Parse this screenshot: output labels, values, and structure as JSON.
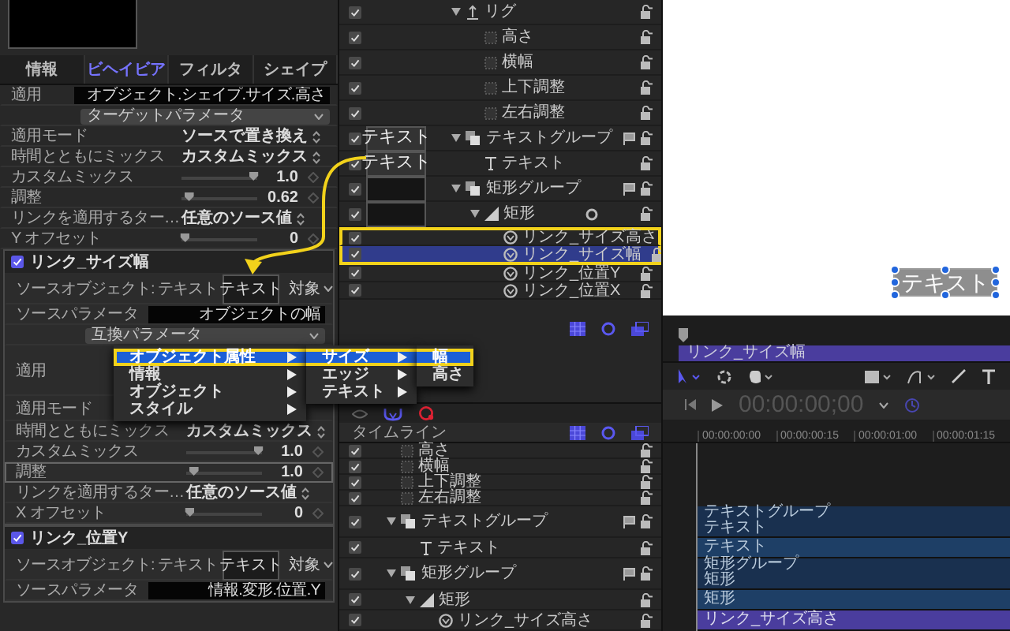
{
  "inspector": {
    "tabs": [
      {
        "label": "情報",
        "selected": false
      },
      {
        "label": "ビヘイビア",
        "selected": true
      },
      {
        "label": "フィルタ",
        "selected": false
      },
      {
        "label": "シェイプ",
        "selected": false
      }
    ],
    "sections": [
      {
        "rows": [
          {
            "kind": "field",
            "label": "適用",
            "value": "オブジェクト.シェイプ.サイズ.高さ",
            "focused": false
          },
          {
            "kind": "dropdown",
            "value": "ターゲットパラメータ",
            "focused": false
          },
          {
            "kind": "popup",
            "label": "適用モード",
            "value": "ソースで置き換え",
            "focused": false
          },
          {
            "kind": "popup",
            "label": "時間とともにミックス",
            "value": "カスタムミックス",
            "focused": false
          },
          {
            "kind": "slider",
            "label": "カスタムミックス",
            "level": 0.95,
            "value": "1.0",
            "focused": false
          },
          {
            "kind": "slider",
            "label": "調整",
            "level": 0.1,
            "value": "0.62",
            "focused": false
          },
          {
            "kind": "popup",
            "label": "リンクを適用するター…",
            "value": "任意のソース値",
            "focused": false
          },
          {
            "kind": "slider",
            "label": "Y オフセット",
            "level": 0.05,
            "value": "0",
            "focused": false
          }
        ]
      },
      {
        "title": "リンク_サイズ幅",
        "enabled": true,
        "rows": [
          {
            "kind": "source",
            "label": "ソースオブジェクト: テキスト",
            "thumbnail": "テキスト",
            "button": "対象",
            "focused": false
          },
          {
            "kind": "field",
            "label": "ソースパラメータ",
            "value": "オブジェクトの幅",
            "focused": false
          },
          {
            "kind": "dropdown",
            "value": "互換パラメータ",
            "focused": false
          },
          {
            "kind": "covered",
            "label": "適用",
            "focused": false
          },
          {
            "kind": "covered_short",
            "label": "適用モード",
            "focused": false
          },
          {
            "kind": "popup",
            "label": "時間とともにミックス",
            "value": "カスタムミックス",
            "focused": false
          },
          {
            "kind": "slider",
            "label": "カスタムミックス",
            "level": 0.95,
            "value": "1.0",
            "focused": false
          },
          {
            "kind": "slider",
            "label": "調整",
            "level": 0.1,
            "value": "1.0",
            "focused": true
          },
          {
            "kind": "popup",
            "label": "リンクを適用するター…",
            "value": "任意のソース値",
            "focused": false
          },
          {
            "kind": "slider",
            "label": "X オフセット",
            "level": 0.05,
            "value": "0",
            "focused": false
          }
        ]
      },
      {
        "title": "リンク_位置Y",
        "enabled": true,
        "rows": [
          {
            "kind": "source",
            "label": "ソースオブジェクト: テキスト",
            "thumbnail": "テキスト",
            "button": "対象",
            "focused": false
          },
          {
            "kind": "field",
            "label": "ソースパラメータ",
            "value": "情報.変形.位置.Y",
            "focused": false
          }
        ]
      }
    ]
  },
  "menu": {
    "columns": [
      {
        "items": [
          {
            "label": "オブジェクト属性",
            "submenu": true,
            "selected": true
          },
          {
            "label": "情報",
            "submenu": true,
            "selected": false
          },
          {
            "label": "オブジェクト",
            "submenu": true,
            "selected": false
          },
          {
            "label": "スタイル",
            "submenu": true,
            "selected": false
          }
        ]
      },
      {
        "items": [
          {
            "label": "サイズ",
            "submenu": true,
            "selected": true
          },
          {
            "label": "エッジ",
            "submenu": true,
            "selected": false
          },
          {
            "label": "テキスト",
            "submenu": true,
            "selected": false
          }
        ]
      },
      {
        "items": [
          {
            "label": "幅",
            "submenu": false,
            "selected": true
          },
          {
            "label": "高さ",
            "submenu": false,
            "selected": false
          }
        ]
      }
    ]
  },
  "layers": {
    "items": [
      {
        "name": "リグ",
        "kind": "rig",
        "checked": true,
        "selected": false,
        "expanded": true,
        "children": [
          {
            "name": "高さ",
            "kind": "param",
            "checked": true,
            "selected": false
          },
          {
            "name": "横幅",
            "kind": "param",
            "checked": true,
            "selected": false
          },
          {
            "name": "上下調整",
            "kind": "param",
            "checked": true,
            "selected": false
          },
          {
            "name": "左右調整",
            "kind": "param",
            "checked": true,
            "selected": false
          }
        ]
      },
      {
        "name": "テキストグループ",
        "kind": "group",
        "checked": true,
        "selected": false,
        "expanded": true,
        "preview": {
          "kind": "text",
          "label": "テキスト"
        },
        "children": [
          {
            "name": "テキスト",
            "kind": "text",
            "checked": true,
            "selected": false,
            "preview": {
              "kind": "text",
              "label": "テキスト"
            }
          }
        ]
      },
      {
        "name": "矩形グループ",
        "kind": "group",
        "checked": true,
        "selected": false,
        "expanded": true,
        "preview": {
          "kind": "blank"
        },
        "children": [
          {
            "name": "矩形",
            "kind": "shape",
            "checked": true,
            "selected": false,
            "expanded": true,
            "preview": {
              "kind": "blank"
            },
            "children": [
              {
                "name": "リンク_サイズ高さ",
                "kind": "behavior",
                "checked": true,
                "selected": false,
                "highlighted": true
              },
              {
                "name": "リンク_サイズ幅",
                "kind": "behavior",
                "checked": true,
                "selected": true,
                "highlighted": true
              },
              {
                "name": "リンク_位置Y",
                "kind": "behavior",
                "checked": true,
                "selected": false,
                "highlighted": false
              },
              {
                "name": "リンク_位置X",
                "kind": "behavior",
                "checked": true,
                "selected": false,
                "highlighted": false
              }
            ]
          }
        ]
      }
    ]
  },
  "timeline_header": {
    "title": "タイムライン"
  },
  "timeline_layers": {
    "items": [
      {
        "name": "高さ",
        "kind": "param",
        "checked": true,
        "selected": false
      },
      {
        "name": "横幅",
        "kind": "param",
        "checked": true,
        "selected": false
      },
      {
        "name": "上下調整",
        "kind": "param",
        "checked": true,
        "selected": false
      },
      {
        "name": "左右調整",
        "kind": "param",
        "checked": true,
        "selected": false
      },
      {
        "name": "テキストグループ",
        "kind": "group",
        "checked": true,
        "selected": false,
        "expanded": true,
        "children": [
          {
            "name": "テキスト",
            "kind": "text",
            "checked": true,
            "selected": false
          }
        ]
      },
      {
        "name": "矩形グループ",
        "kind": "group",
        "checked": true,
        "selected": false,
        "expanded": true,
        "children": [
          {
            "name": "矩形",
            "kind": "shape",
            "checked": true,
            "selected": false,
            "expanded": true,
            "children": [
              {
                "name": "リンク_サイズ高さ",
                "kind": "behavior",
                "checked": true,
                "selected": false
              }
            ]
          }
        ]
      }
    ]
  },
  "canvas": {
    "object_text": "テキスト"
  },
  "mini_timeline": {
    "bar": {
      "kind": "behavior",
      "label": "リンク_サイズ幅"
    }
  },
  "transport": {
    "timecode": "00:00:00;00"
  },
  "timeline": {
    "ticks": [
      "00:00:00:00",
      "00:00:00:15",
      "00:00:01:00",
      "00:00:01:15"
    ],
    "tracks": [
      {
        "kind": "group",
        "lines": [
          "テキストグループ",
          "テキスト"
        ]
      },
      {
        "kind": "layer",
        "lines": [
          "テキスト"
        ]
      },
      {
        "kind": "group",
        "lines": [
          "矩形グループ",
          "矩形"
        ]
      },
      {
        "kind": "layer",
        "lines": [
          "矩形"
        ]
      },
      {
        "kind": "behavior",
        "lines": [
          "リンク_サイズ高さ"
        ]
      }
    ]
  }
}
